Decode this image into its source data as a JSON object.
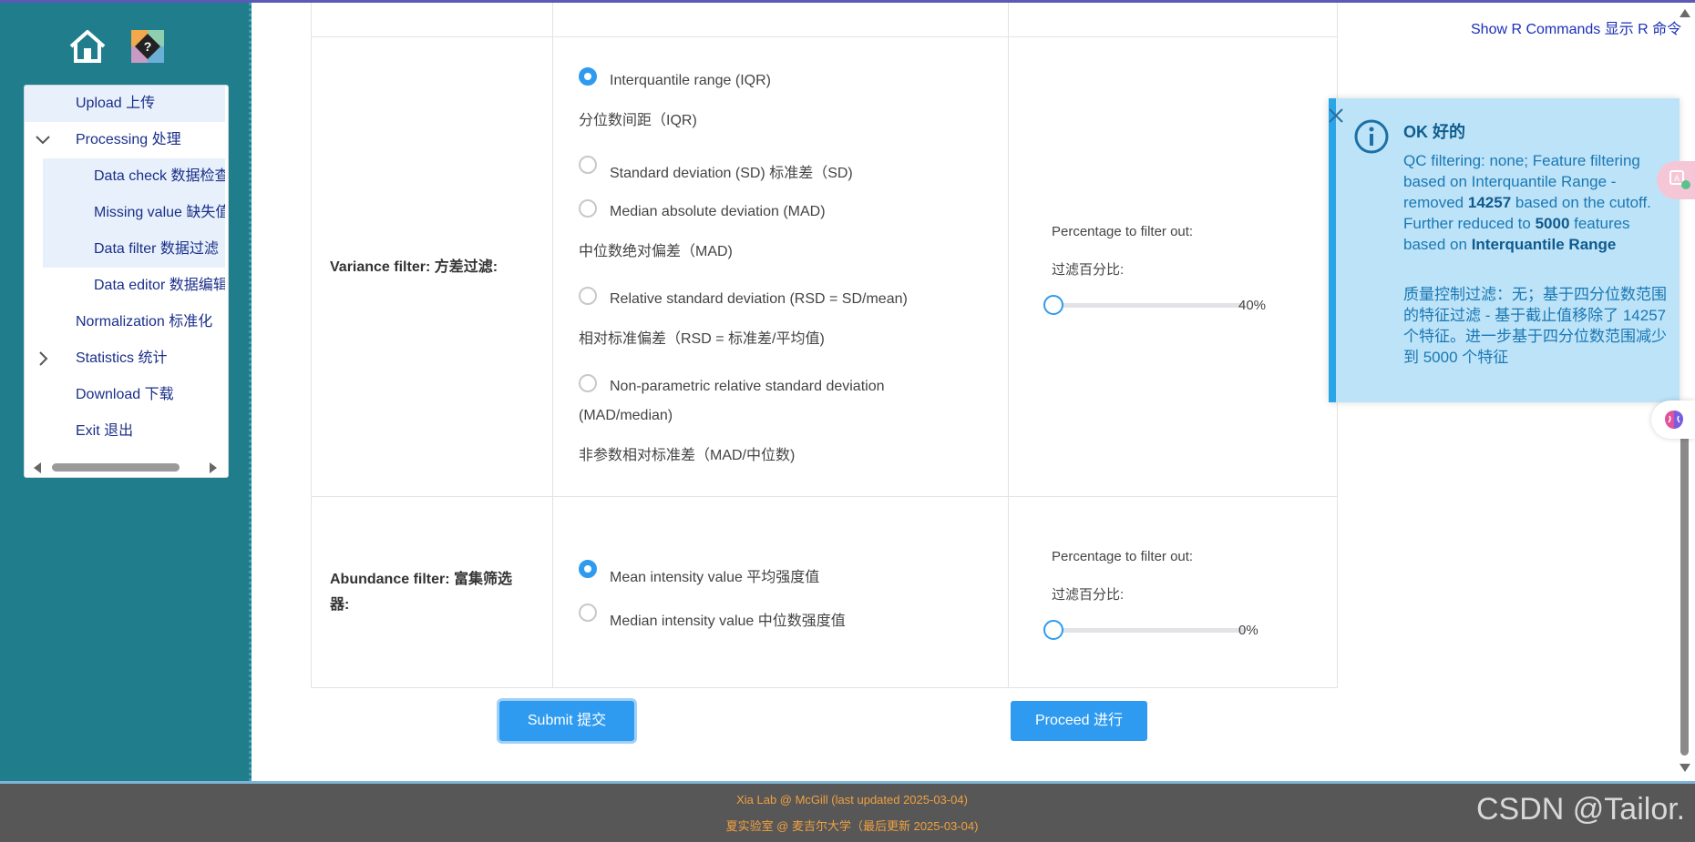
{
  "sidebar": {
    "items": [
      {
        "label": "Upload  上传"
      },
      {
        "label": "Processing  处理"
      },
      {
        "label": "Data check  数据检查"
      },
      {
        "label": "Missing value  缺失值"
      },
      {
        "label": "Data filter  数据过滤"
      },
      {
        "label": "Data editor  数据编辑"
      },
      {
        "label": "Normalization  标准化"
      },
      {
        "label": "Statistics  统计"
      },
      {
        "label": "Download  下载"
      },
      {
        "label": "Exit  退出"
      }
    ]
  },
  "header": {
    "show_r": "Show R Commands  显示 R 命令"
  },
  "variance": {
    "label": "Variance filter:  方差过滤:",
    "options": [
      {
        "label": "Interquantile range (IQR)",
        "sub": "分位数间距（IQR)",
        "selected": true
      },
      {
        "label": "Standard deviation (SD)  标准差（SD)",
        "sub": "",
        "selected": false
      },
      {
        "label": "Median absolute deviation (MAD)",
        "sub": "中位数绝对偏差（MAD)",
        "selected": false
      },
      {
        "label": "Relative standard deviation (RSD = SD/mean)",
        "sub": "相对标准偏差（RSD = 标准差/平均值)",
        "selected": false
      },
      {
        "label": "Non-parametric relative standard deviation",
        "label2": "(MAD/median)",
        "sub": "非参数相对标准差（MAD/中位数)",
        "selected": false
      }
    ],
    "pct_label": "Percentage to filter out:",
    "pct_label_zh": "过滤百分比:",
    "pct_value": "40%",
    "pct_fraction": 0.4
  },
  "abundance": {
    "label": "Abundance filter:  富集筛选",
    "label2": "器:",
    "options": [
      {
        "label": "Mean intensity value  平均强度值",
        "selected": true
      },
      {
        "label": "Median intensity value  中位数强度值",
        "selected": false
      }
    ],
    "pct_label": "Percentage to filter out:",
    "pct_label_zh": "过滤百分比:",
    "pct_value": "0%",
    "pct_fraction": 0.0
  },
  "buttons": {
    "submit": "Submit  提交",
    "proceed": "Proceed  进行"
  },
  "toast": {
    "title": "OK  好的",
    "body_1": "QC filtering: none; Feature filtering based on Interquantile Range - removed ",
    "body_n1": "14257",
    "body_2": " based on the cutoff. Further reduced to ",
    "body_n2": "5000",
    "body_3": " features based on ",
    "body_method": "Interquantile Range",
    "body_zh": "质量控制过滤：无；基于四分位数范围的特征过滤 - 基于截止值移除了 14257 个特征。进一步基于四分位数范围减少到 5000 个特征"
  },
  "footer": {
    "line1": "Xia Lab @ McGill    (last updated 2025-03-04)",
    "line2": "夏实验室 @ 麦吉尔大学（最后更新 2025-03-04)"
  },
  "watermark": "CSDN @Tailor.",
  "colors": {
    "sidebar_bg": "#1f7d8c",
    "accent": "#2f9bf0",
    "toast_bg": "#bde3f8",
    "footer_bg": "#575757",
    "footer_text": "#f0a040"
  }
}
